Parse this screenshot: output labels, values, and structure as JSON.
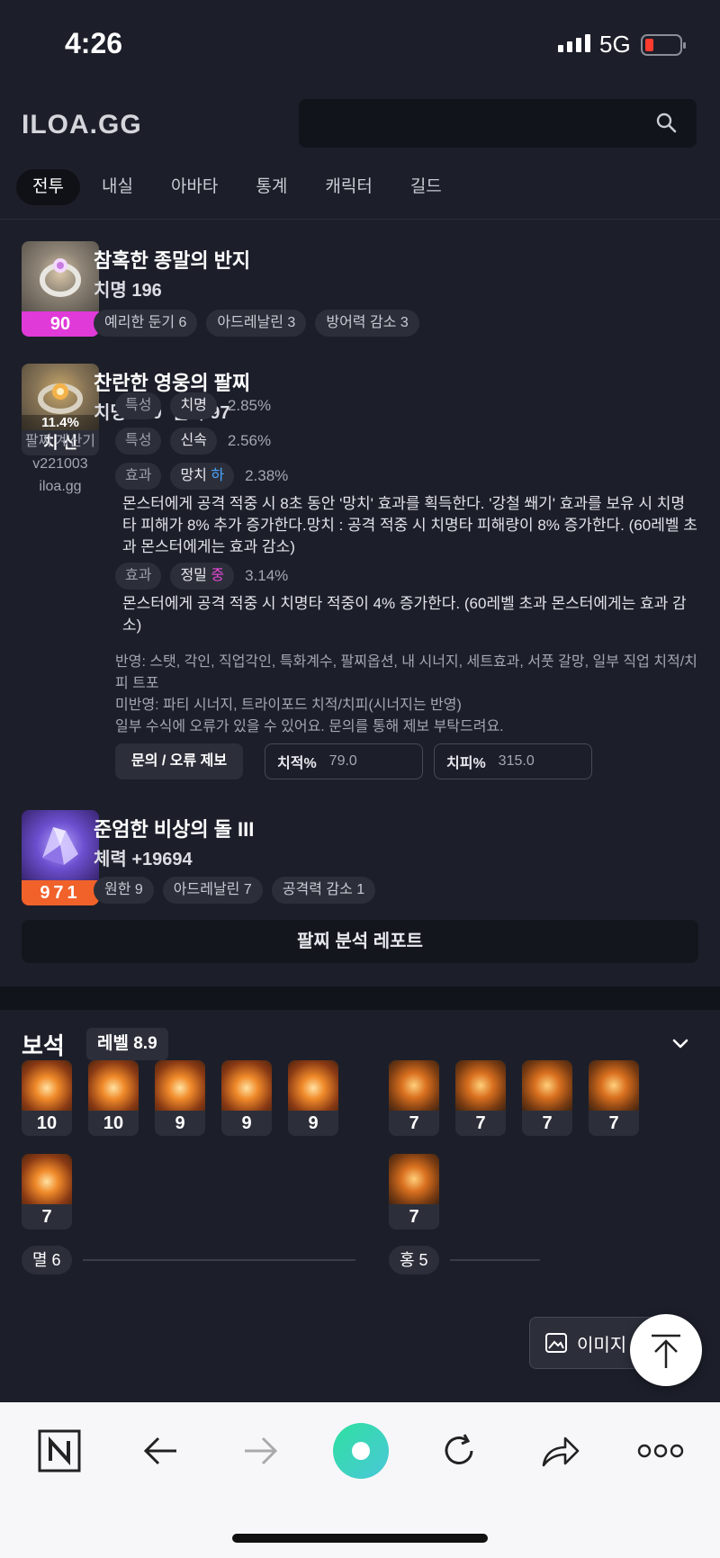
{
  "status": {
    "time": "4:26",
    "network": "5G"
  },
  "header": {
    "logo": "ILOA.GG",
    "tabs": [
      "전투",
      "내실",
      "아바타",
      "통계",
      "캐릭터",
      "길드"
    ]
  },
  "ring": {
    "quality": "90",
    "name": "참혹한 종말의 반지",
    "stats": "치명 196",
    "engravings": [
      "예리한 둔기 6",
      "아드레날린 3",
      "방어력 감소 3"
    ]
  },
  "bracelet": {
    "top_pct": "11.4%",
    "badge": "치 신",
    "name": "찬란한 영웅의 팔찌",
    "stats": "치명 100  신속 97",
    "calculator": [
      "팔찌 계산기",
      "v221003",
      "iloa.gg"
    ],
    "lines": [
      {
        "kind": "특성",
        "name": "치명",
        "pct": "2.85%"
      },
      {
        "kind": "특성",
        "name": "신속",
        "pct": "2.56%"
      },
      {
        "kind": "효과",
        "name": "망치 ",
        "grade": "하",
        "pct": "2.38%"
      },
      {
        "kind": "효과",
        "name": "정밀 ",
        "grade": "중",
        "pct": "3.14%"
      }
    ],
    "hammer_desc": "몬스터에게 공격 적중 시 8초 동안 '망치' 효과를 획득한다. '강철 쐐기' 효과를 보유 시 치명타 피해가 8% 추가 증가한다.망치 : 공격 적중 시 치명타 피해량이 8% 증가한다. (60레벨 초과 몬스터에게는 효과 감소)",
    "precision_desc": "몬스터에게 공격 적중 시 치명타 적중이 4% 증가한다. (60레벨 초과 몬스터에게는 효과 감소)",
    "notes": [
      "반영: 스탯, 각인, 직업각인, 특화계수, 팔찌옵션, 내 시너지, 세트효과, 서풋 갈망, 일부 직업 치적/치피 트포",
      "미반영: 파티 시너지, 트라이포드 치적/치피(시너지는 반영)",
      "일부 수식에 오류가 있을 수 있어요. 문의를 통해 제보 부탁드려요."
    ],
    "report_btn": "문의 / 오류 제보",
    "crit_rate_label": "치적%",
    "crit_rate_value": "79.0",
    "crit_dmg_label": "치피%",
    "crit_dmg_value": "315.0"
  },
  "stone": {
    "quality": "971",
    "name": "준엄한 비상의 돌 III",
    "stats": "체력 +19694",
    "engravings": [
      "원한 9",
      "아드레날린 7",
      "공격력 감소 1"
    ]
  },
  "analysis_button": "팔찌 분석 레포트",
  "gems": {
    "title": "보석",
    "level": "레벨 8.9",
    "left": [
      "10",
      "10",
      "9",
      "9",
      "9",
      "7"
    ],
    "right": [
      "7",
      "7",
      "7",
      "7",
      "7"
    ],
    "left_summary": "멸 6",
    "right_summary": "홍 5"
  },
  "floating": {
    "image_button": "이미지"
  }
}
